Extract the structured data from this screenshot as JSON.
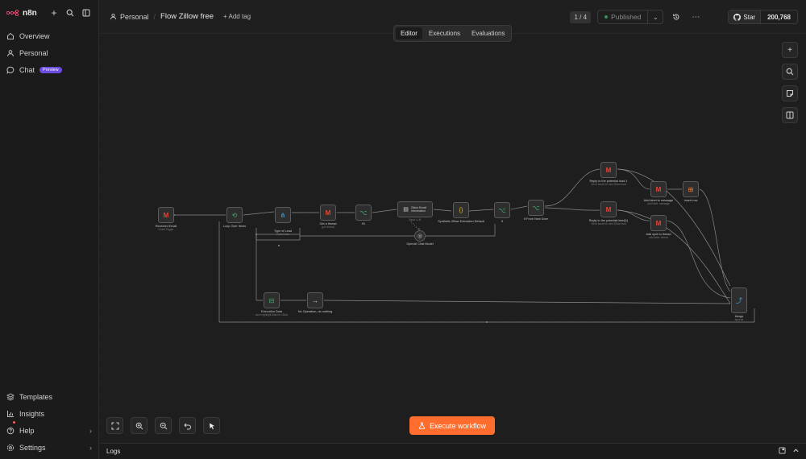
{
  "sidebar": {
    "brand": "n8n",
    "nav": [
      {
        "label": "Overview",
        "icon": "home-icon"
      },
      {
        "label": "Personal",
        "icon": "user-icon"
      },
      {
        "label": "Chat",
        "icon": "chat-icon",
        "badge": "Preview"
      }
    ],
    "bottom": [
      {
        "label": "Templates",
        "icon": "templates-icon"
      },
      {
        "label": "Insights",
        "icon": "insights-icon"
      },
      {
        "label": "Help",
        "icon": "help-icon"
      },
      {
        "label": "Settings",
        "icon": "settings-icon"
      }
    ]
  },
  "header": {
    "project": "Personal",
    "workflow_title": "Flow Zillow free",
    "add_tag": "+ Add tag",
    "version": "1 / 4",
    "published": "Published",
    "github_star": "Star",
    "github_count": "200,768"
  },
  "tabs": [
    {
      "label": "Editor",
      "active": true
    },
    {
      "label": "Executions",
      "active": false
    },
    {
      "label": "Evaluations",
      "active": false
    }
  ],
  "nodes": [
    {
      "id": "received-email",
      "label": "Received Email",
      "sub": "Gmail Trigger",
      "icon": "M",
      "color": "#ea4335"
    },
    {
      "id": "loop-over-items",
      "label": "Loop Over Items",
      "sub": "",
      "icon": "⟲",
      "color": "#3fb26e"
    },
    {
      "id": "type-of-lead",
      "label": "Type of Lead",
      "sub": "Code Node",
      "icon": "⋔",
      "color": "#4aa3df"
    },
    {
      "id": "get-a-thread",
      "label": "Get a thread",
      "sub": "get: thread",
      "icon": "M",
      "color": "#ea4335"
    },
    {
      "id": "if",
      "label": "If1",
      "sub": "",
      "icon": "⌥",
      "color": "#3fb26e"
    },
    {
      "id": "zillow-email-info",
      "label": "Zillow Email Information",
      "sub": "Basic LLM",
      "icon": "▤",
      "color": "#cfcfcf"
    },
    {
      "id": "openai-chat-model",
      "label": "OpenAI Chat Model",
      "sub": "",
      "icon": "◎",
      "color": "#cfcfcf"
    },
    {
      "id": "synthetic-zillow-extraction",
      "label": "Synthetic Zillow Extraction Default",
      "sub": "",
      "icon": "{}",
      "color": "#f2b531"
    },
    {
      "id": "if-2",
      "label": "If",
      "sub": "",
      "icon": "⌥",
      "color": "#3fb26e"
    },
    {
      "id": "if-from-new-doer",
      "label": "If From New Doer",
      "sub": "",
      "icon": "⌥",
      "color": "#3fb26e"
    },
    {
      "id": "reply-to-lead-1",
      "label": "Reply to the potential lead 1",
      "sub": "Send email for new Zillow lead",
      "icon": "M",
      "color": "#ea4335"
    },
    {
      "id": "reply-to-lead-2",
      "label": "Reply to the potential lead(1)",
      "sub": "Send email for new Zillow lead",
      "icon": "M",
      "color": "#ea4335"
    },
    {
      "id": "add-label-to-message",
      "label": "Add label to message",
      "sub": "add label: message",
      "icon": "M",
      "color": "#ea4335"
    },
    {
      "id": "add-spot-to-thread",
      "label": "Add spot to thread",
      "sub": "add label: thread",
      "icon": "M",
      "color": "#ea4335"
    },
    {
      "id": "insert-row",
      "label": "Insert row",
      "sub": "",
      "icon": "⊞",
      "color": "#ff7a2f"
    },
    {
      "id": "execution-data",
      "label": "Execution Data",
      "sub": "save highlight data for Zillow",
      "icon": "⊟",
      "color": "#3fb26e"
    },
    {
      "id": "no-operation",
      "label": "No Operation, do nothing",
      "sub": "",
      "icon": "→",
      "color": "#cfcfcf"
    },
    {
      "id": "merge",
      "label": "Merge",
      "sub": "append",
      "icon": "⤴",
      "color": "#4aa3df"
    }
  ],
  "execute_button": "Execute workflow",
  "logs_label": "Logs"
}
